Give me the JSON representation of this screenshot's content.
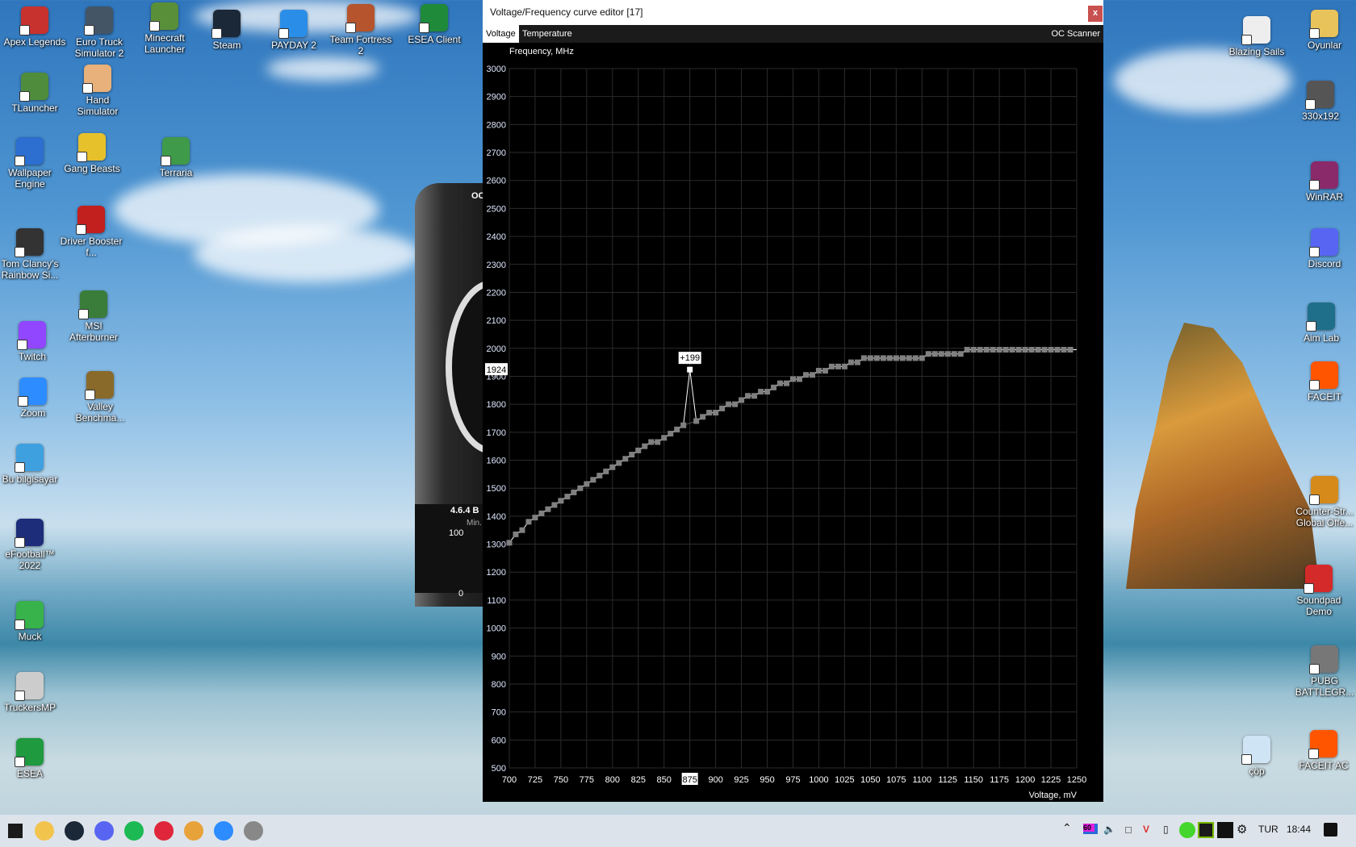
{
  "desktop": {
    "icons": [
      {
        "label": "Apex Legends",
        "color": "#c7322f"
      },
      {
        "label": "Euro Truck Simulator 2",
        "color": "#445566"
      },
      {
        "label": "Minecraft Launcher",
        "color": "#5a8f3a"
      },
      {
        "label": "Steam",
        "color": "#1b2838"
      },
      {
        "label": "PAYDAY 2",
        "color": "#2a8ee8"
      },
      {
        "label": "Team Fortress 2",
        "color": "#b5542d"
      },
      {
        "label": "ESEA Client",
        "color": "#1f8a3a"
      },
      {
        "label": "TLauncher",
        "color": "#4f8c3c"
      },
      {
        "label": "Hand Simulator",
        "color": "#e8b07a"
      },
      {
        "label": "Wallpaper Engine",
        "color": "#2c6fd1"
      },
      {
        "label": "Gang Beasts",
        "color": "#e6c12c"
      },
      {
        "label": "Terraria",
        "color": "#3f9a4a"
      },
      {
        "label": "Tom Clancy's Rainbow Si...",
        "color": "#333333"
      },
      {
        "label": "Driver Booster f...",
        "color": "#c21f1f"
      },
      {
        "label": "MSI Afterburner",
        "color": "#3a7d3a"
      },
      {
        "label": "Twitch",
        "color": "#9146ff"
      },
      {
        "label": "Zoom",
        "color": "#2d8cff"
      },
      {
        "label": "Valley Benchma...",
        "color": "#8a6a2a"
      },
      {
        "label": "Bu bilgisayar",
        "color": "#3fa0e0"
      },
      {
        "label": "eFootball™ 2022",
        "color": "#1d2d7a"
      },
      {
        "label": "Muck",
        "color": "#38b24a"
      },
      {
        "label": "TruckersMP",
        "color": "#cccccc"
      },
      {
        "label": "ESEA",
        "color": "#1f9a3f"
      },
      {
        "label": "Oyunlar",
        "color": "#e8c25a"
      },
      {
        "label": "Blazing Sails",
        "color": "#eeeeee"
      },
      {
        "label": "330x192",
        "color": "#555555"
      },
      {
        "label": "WinRAR",
        "color": "#8a2a6a"
      },
      {
        "label": "Discord",
        "color": "#5865f2"
      },
      {
        "label": "Aim Lab",
        "color": "#1f6f8a"
      },
      {
        "label": "FACEIT",
        "color": "#ff5500"
      },
      {
        "label": "Counter-Str... Global Offe...",
        "color": "#d68a1a"
      },
      {
        "label": "Soundpad Demo",
        "color": "#d42a2a"
      },
      {
        "label": "PUBG BATTLEGR...",
        "color": "#777777"
      },
      {
        "label": "çöp",
        "color": "#cfe4f5"
      },
      {
        "label": "FACEIT AC",
        "color": "#ff5500"
      }
    ]
  },
  "afterburner": {
    "oc": "OC",
    "version": "4.6.4 B",
    "min": "Min.",
    "v100": "100",
    "v0": "0"
  },
  "window": {
    "title": "Voltage/Frequency curve editor [17]",
    "close_label": "x",
    "tabs": [
      {
        "label": "Voltage",
        "active": true
      },
      {
        "label": "Temperature",
        "active": false
      }
    ],
    "oc_scanner": "OC Scanner"
  },
  "chart_data": {
    "type": "line",
    "ylabel": "Frequency, MHz",
    "xlabel": "Voltage, mV",
    "xlim": [
      700,
      1250
    ],
    "ylim": [
      500,
      3000
    ],
    "xticks": [
      700,
      725,
      750,
      775,
      800,
      825,
      850,
      875,
      900,
      925,
      950,
      975,
      1000,
      1025,
      1050,
      1075,
      1100,
      1125,
      1150,
      1175,
      1200,
      1225,
      1250
    ],
    "yticks": [
      500,
      600,
      700,
      800,
      900,
      1000,
      1100,
      1200,
      1300,
      1400,
      1500,
      1600,
      1700,
      1800,
      1900,
      2000,
      2100,
      2200,
      2300,
      2400,
      2500,
      2600,
      2700,
      2800,
      2900,
      3000
    ],
    "grid": true,
    "selected_voltage": "875",
    "selected_frequency": "1924",
    "selected_offset": "+199",
    "colors": {
      "background": "#000000",
      "grid": "#2b2b2b",
      "point": "#808080",
      "line": "#ffffff",
      "selected": "#ffffff"
    },
    "x": [
      700,
      706.25,
      712.5,
      718.75,
      725,
      731.25,
      737.5,
      743.75,
      750,
      756.25,
      762.5,
      768.75,
      775,
      781.25,
      787.5,
      793.75,
      800,
      806.25,
      812.5,
      818.75,
      825,
      831.25,
      837.5,
      843.75,
      850,
      856.25,
      862.5,
      868.75,
      875,
      881.25,
      887.5,
      893.75,
      900,
      906.25,
      912.5,
      918.75,
      925,
      931.25,
      937.5,
      943.75,
      950,
      956.25,
      962.5,
      968.75,
      975,
      981.25,
      987.5,
      993.75,
      1000,
      1006.25,
      1012.5,
      1018.75,
      1025,
      1031.25,
      1037.5,
      1043.75,
      1050,
      1056.25,
      1062.5,
      1068.75,
      1075,
      1081.25,
      1087.5,
      1093.75,
      1100,
      1106.25,
      1112.5,
      1118.75,
      1125,
      1131.25,
      1137.5,
      1143.75,
      1150,
      1156.25,
      1162.5,
      1168.75,
      1175,
      1181.25,
      1187.5,
      1193.75,
      1200,
      1206.25,
      1212.5,
      1218.75,
      1225,
      1231.25,
      1237.5,
      1243.75
    ],
    "y": [
      1305,
      1335,
      1350,
      1380,
      1395,
      1410,
      1425,
      1440,
      1455,
      1470,
      1485,
      1500,
      1515,
      1530,
      1545,
      1560,
      1575,
      1590,
      1605,
      1620,
      1635,
      1650,
      1665,
      1665,
      1680,
      1695,
      1710,
      1725,
      1924,
      1740,
      1755,
      1770,
      1770,
      1785,
      1800,
      1800,
      1815,
      1830,
      1830,
      1845,
      1845,
      1860,
      1875,
      1875,
      1890,
      1890,
      1905,
      1905,
      1920,
      1920,
      1935,
      1935,
      1935,
      1950,
      1950,
      1965,
      1965,
      1965,
      1965,
      1965,
      1965,
      1965,
      1965,
      1965,
      1965,
      1980,
      1980,
      1980,
      1980,
      1980,
      1980,
      1995,
      1995,
      1995,
      1995,
      1995,
      1995,
      1995,
      1995,
      1995,
      1995,
      1995,
      1995,
      1995,
      1995,
      1995,
      1995,
      1995
    ]
  },
  "taskbar": {
    "apps": [
      {
        "icon": "windows-start-icon",
        "color": "#1a1a1a"
      },
      {
        "icon": "file-explorer-icon",
        "color": "#f2c44e"
      },
      {
        "icon": "steam-icon",
        "color": "#1b2838"
      },
      {
        "icon": "discord-icon",
        "color": "#5865f2"
      },
      {
        "icon": "spotify-icon",
        "color": "#1db954"
      },
      {
        "icon": "opera-icon",
        "color": "#e0263a"
      },
      {
        "icon": "chrome-icon",
        "color": "#e8a23a"
      },
      {
        "icon": "zoom-icon",
        "color": "#2d8cff"
      },
      {
        "icon": "snipping-icon",
        "color": "#888888"
      }
    ],
    "tray": {
      "fps_badge": "60",
      "language": "TUR",
      "time": "18:44",
      "icons": [
        "chevron-up-icon",
        "monitor-fps-icon",
        "volume-icon",
        "wifi-icon",
        "valorant-icon",
        "usb-icon",
        "razer-icon",
        "nvidia-icon",
        "aorus-icon",
        "steelseries-icon"
      ]
    }
  }
}
